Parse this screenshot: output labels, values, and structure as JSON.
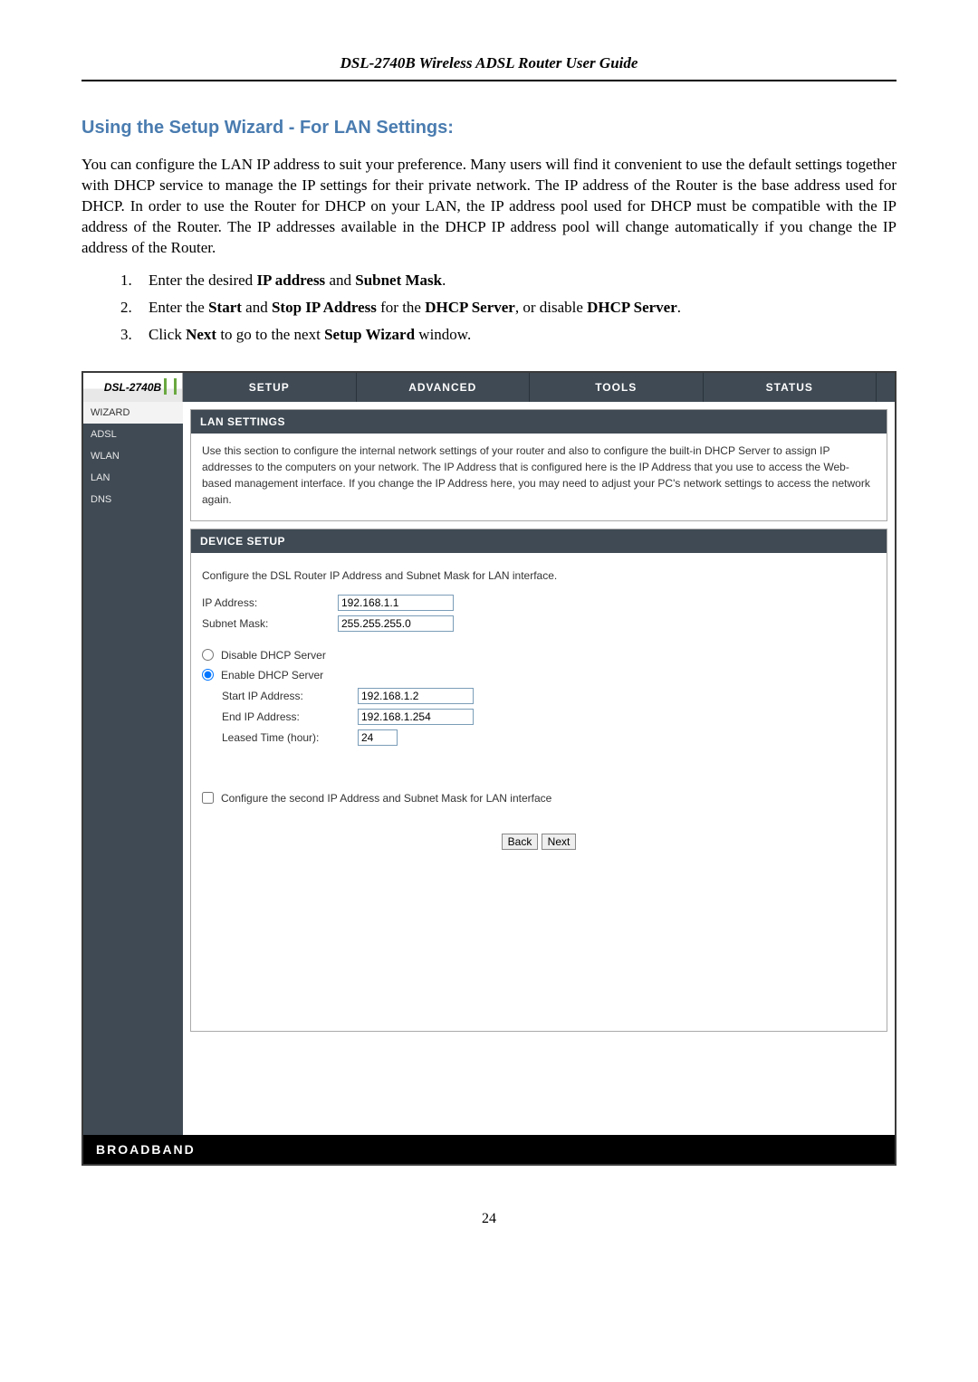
{
  "doc_header": "DSL-2740B Wireless ADSL Router User Guide",
  "section_title": "Using the Setup Wizard - For LAN Settings:",
  "intro": "You can configure the LAN IP address to suit your preference. Many users will find it convenient to use the default settings together with DHCP service to manage the IP settings for their private network. The IP address of the Router is the base address used for DHCP. In order to use the Router for DHCP on your LAN, the IP address pool used for DHCP must be compatible with the IP address of the Router. The IP addresses available in the DHCP IP address pool will change automatically if you change the IP address of the Router.",
  "steps": [
    {
      "pre": "Enter the desired ",
      "b1": "IP address",
      "mid": " and ",
      "b2": "Subnet Mask",
      "post": "."
    },
    {
      "pre": "Enter the ",
      "b1": "Start",
      "mid": " and ",
      "b2": "Stop IP Address",
      "mid2": " for the ",
      "b3": "DHCP Server",
      "mid3": ", or disable ",
      "b4": "DHCP Server",
      "post": "."
    },
    {
      "pre": "Click ",
      "b1": "Next",
      "mid": " to go to the next ",
      "b2": "Setup Wizard",
      "post": " window."
    }
  ],
  "router": {
    "logo": "DSL-2740B",
    "tabs": [
      "SETUP",
      "ADVANCED",
      "TOOLS",
      "STATUS"
    ],
    "side": [
      "WIZARD",
      "ADSL",
      "WLAN",
      "LAN",
      "DNS"
    ],
    "panel1": {
      "title": "LAN SETTINGS",
      "text": "Use this section to configure the internal network settings of your router and also to configure the built-in DHCP Server to assign IP addresses to the computers on your network. The IP Address that is configured here is the IP Address that you use to access the Web-based management interface. If you change the IP Address here, you may need to adjust your PC's network settings to access the network again."
    },
    "panel2": {
      "title": "DEVICE SETUP",
      "desc": "Configure the DSL Router IP Address and Subnet Mask for LAN interface.",
      "ip_label": "IP Address:",
      "ip_value": "192.168.1.1",
      "mask_label": "Subnet Mask:",
      "mask_value": "255.255.255.0",
      "disable_label": "Disable DHCP Server",
      "enable_label": "Enable DHCP Server",
      "start_label": "Start IP Address:",
      "start_value": "192.168.1.2",
      "end_label": "End IP Address:",
      "end_value": "192.168.1.254",
      "lease_label": "Leased Time (hour):",
      "lease_value": "24",
      "second_ip_label": "Configure the second IP Address and Subnet Mask for LAN interface",
      "back_btn": "Back",
      "next_btn": "Next"
    },
    "footer": "BROADBAND"
  },
  "page_number": "24"
}
